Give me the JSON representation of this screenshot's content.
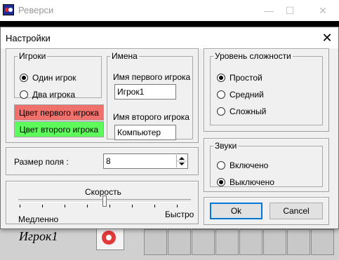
{
  "main_window": {
    "title": "Реверси",
    "minimize_glyph": "—",
    "maximize_glyph": "☐",
    "close_glyph": "✕",
    "current_player": "Игрок1"
  },
  "dialog": {
    "title": "Настройки",
    "close_glyph": "✕",
    "players": {
      "legend": "Игроки",
      "one_player": "Один игрок",
      "two_players": "Два игрока",
      "selected": "one_player"
    },
    "names": {
      "legend": "Имена",
      "first_label": "Имя первого игрока",
      "first_value": "Игрок1",
      "second_label": "Имя второго игрока",
      "second_value": "Компьютер"
    },
    "color_buttons": {
      "first": "Цвет первого игрока",
      "second": "Цвет второго игрока",
      "first_color": "#f0706c",
      "second_color": "#5dfc5a"
    },
    "board_size": {
      "label": "Размер поля :",
      "value": "8"
    },
    "speed": {
      "label": "Скорость",
      "min_label": "Медленно",
      "max_label": "Быстро",
      "value_fraction": 0.5
    },
    "difficulty": {
      "legend": "Уровень сложности",
      "easy": "Простой",
      "medium": "Средний",
      "hard": "Сложный",
      "selected": "easy"
    },
    "sound": {
      "legend": "Звуки",
      "on": "Включено",
      "off": "Выключено",
      "selected": "off"
    },
    "ok_label": "Ok",
    "cancel_label": "Cancel"
  }
}
